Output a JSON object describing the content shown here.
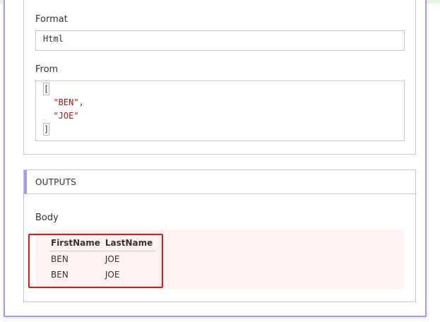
{
  "inputs": {
    "format_label": "Format",
    "format_value": "Html",
    "from_label": "From",
    "from_lines": {
      "open": "[",
      "item1": "\"BEN\",",
      "item2": "\"JOE\"",
      "close": "]"
    }
  },
  "outputs": {
    "title": "OUTPUTS",
    "body_label": "Body",
    "table": {
      "headers": [
        "FirstName",
        "LastName"
      ],
      "rows": [
        [
          "BEN",
          "JOE"
        ],
        [
          "BEN",
          "JOE"
        ]
      ]
    }
  },
  "colors": {
    "accent": "#a89be6",
    "highlight": "#e01818",
    "body_bg": "#fff2f2",
    "string": "#a31515"
  }
}
